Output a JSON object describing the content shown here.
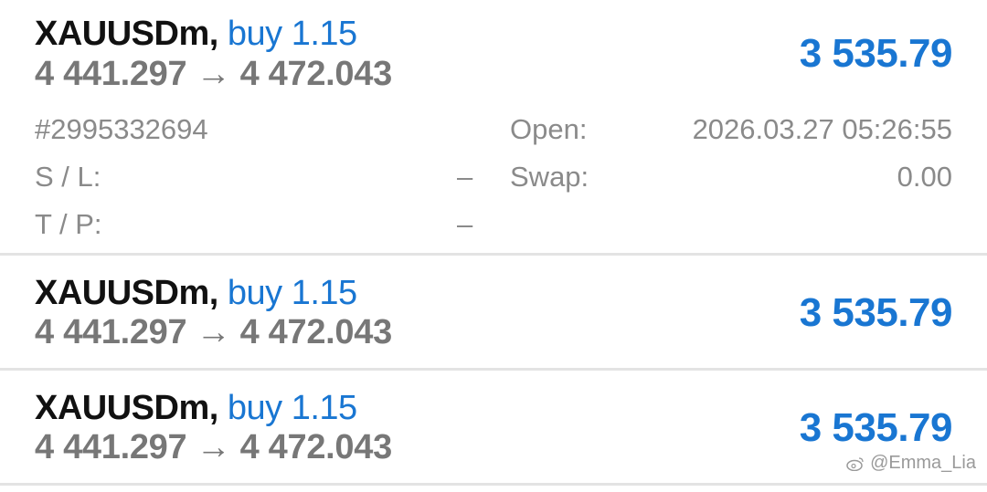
{
  "positions": [
    {
      "symbol": "XAUUSDm",
      "separator": ",",
      "side_volume": "buy 1.15",
      "price_range": "4 441.297 → 4 472.043",
      "profit": "3 535.79",
      "expanded": true,
      "details": {
        "ticket": "#2995332694",
        "sl_label": "S / L:",
        "sl_value": "–",
        "tp_label": "T / P:",
        "tp_value": "–",
        "open_label": "Open:",
        "open_value": "2026.03.27 05:26:55",
        "swap_label": "Swap:",
        "swap_value": "0.00"
      }
    },
    {
      "symbol": "XAUUSDm",
      "separator": ",",
      "side_volume": "buy 1.15",
      "price_range": "4 441.297 → 4 472.043",
      "profit": "3 535.79",
      "expanded": false
    },
    {
      "symbol": "XAUUSDm",
      "separator": ",",
      "side_volume": "buy 1.15",
      "price_range": "4 441.297 → 4 472.043",
      "profit": "3 535.79",
      "expanded": false
    }
  ],
  "watermark": {
    "text": "@Emma_Lia",
    "icon": "weibo-icon"
  },
  "colors": {
    "accent_blue": "#1976d2",
    "symbol_text": "#111111",
    "price_gray": "#777777",
    "detail_gray": "#8a8a8a",
    "divider": "#e3e3e3"
  }
}
